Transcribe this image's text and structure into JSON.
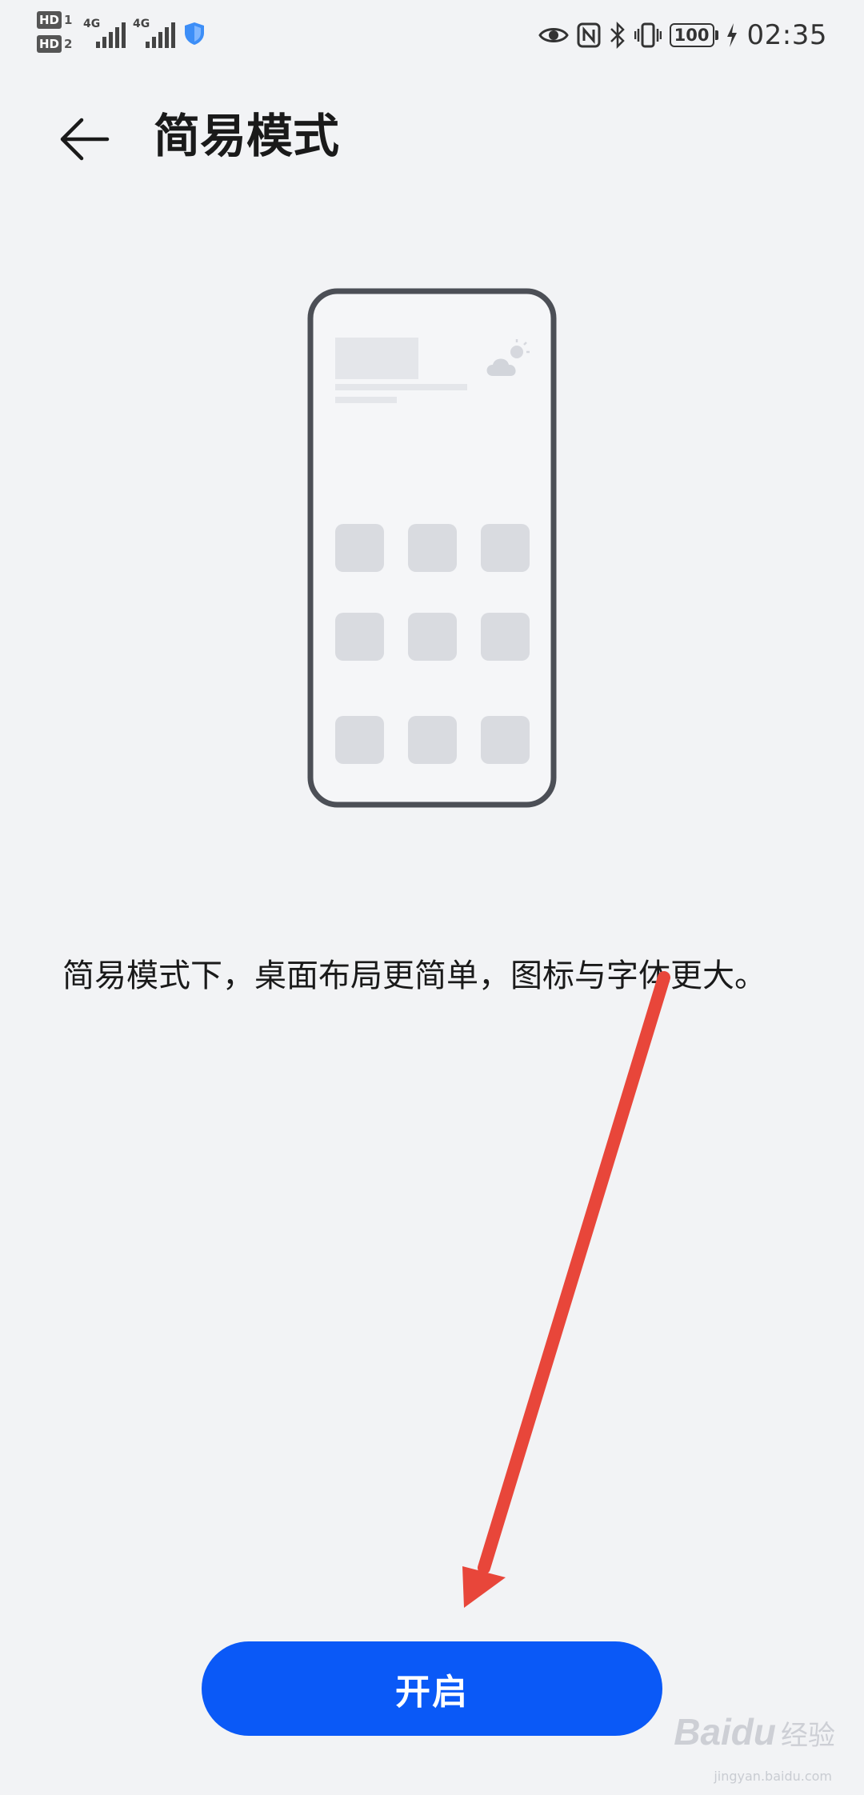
{
  "status_bar": {
    "sim1_badge": "HD",
    "sim1_num": "1",
    "sim2_badge": "HD",
    "sim2_num": "2",
    "network1": "4G",
    "network2": "4G",
    "battery": "100",
    "time": "02:35",
    "icons": [
      "eye-icon",
      "nfc-icon",
      "bluetooth-icon",
      "vibrate-icon",
      "battery-icon",
      "charging-icon"
    ]
  },
  "header": {
    "back_icon": "arrow-left-icon",
    "title": "简易模式"
  },
  "illustration": {
    "icon": "phone-simple-mode-illustration",
    "weather_icon": "partly-cloudy-icon"
  },
  "description": "简易模式下，桌面布局更简单，图标与字体更大。",
  "actions": {
    "enable_label": "开启"
  },
  "watermark": {
    "brand": "Baidu",
    "suffix": "经验",
    "url": "jingyan.baidu.com"
  },
  "colors": {
    "background": "#f2f3f5",
    "primary_button": "#0a59f7",
    "annotation_arrow": "#e8463a"
  }
}
